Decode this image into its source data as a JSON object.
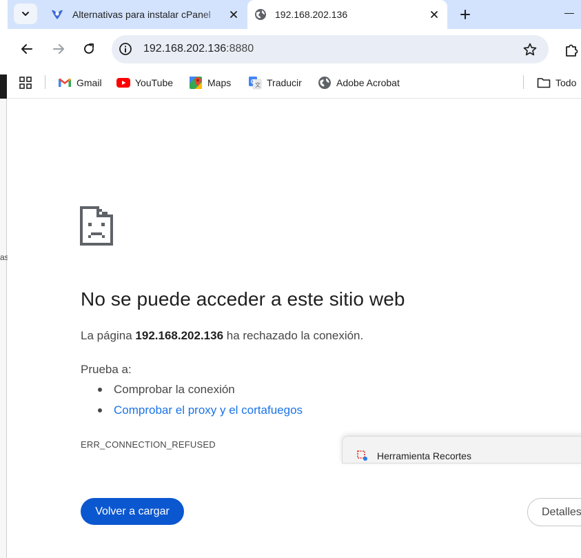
{
  "background_window": {
    "fragment_text": "as"
  },
  "tabs": [
    {
      "title": "Alternativas para instalar cPanel",
      "active": false,
      "favicon": "webmin-icon"
    },
    {
      "title": "192.168.202.136",
      "active": true,
      "favicon": "globe-icon"
    }
  ],
  "omnibox": {
    "host": "192.168.202.136",
    "port_suffix": ":8880"
  },
  "bookmarks": [
    {
      "label": "Gmail",
      "icon": "gmail-icon"
    },
    {
      "label": "YouTube",
      "icon": "youtube-icon"
    },
    {
      "label": "Maps",
      "icon": "maps-icon"
    },
    {
      "label": "Traducir",
      "icon": "translate-icon"
    },
    {
      "label": "Adobe Acrobat",
      "icon": "globe-icon"
    },
    {
      "label": "Todo",
      "icon": "folder-icon"
    }
  ],
  "error_page": {
    "title": "No se puede acceder a este sitio web",
    "desc_prefix": "La página ",
    "desc_host": "192.168.202.136",
    "desc_suffix": " ha rechazado la conexión.",
    "try_label": "Prueba a:",
    "suggestions": [
      {
        "text": "Comprobar la conexión",
        "is_link": false
      },
      {
        "text": "Comprobar el proxy y el cortafuegos",
        "is_link": true
      }
    ],
    "error_code": "ERR_CONNECTION_REFUSED",
    "reload_label": "Volver a cargar",
    "details_label": "Detalles"
  },
  "snipping_popup": {
    "label": "Herramienta Recortes"
  },
  "colors": {
    "tabstrip": "#d3e3fd",
    "omnibox": "#e9eef6",
    "primary_button": "#0b57d0",
    "link": "#1a73e8",
    "youtube_red": "#ff0000"
  }
}
